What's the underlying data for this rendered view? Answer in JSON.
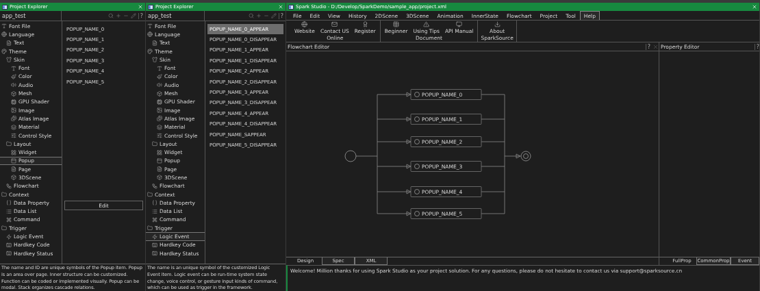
{
  "panels": [
    {
      "title": "Project Explorer",
      "project": "app_test",
      "help": "?",
      "tree": [
        {
          "label": "Font File",
          "selected": false
        },
        {
          "label": "Language",
          "selected": false,
          "children": [
            {
              "label": "Text",
              "selected": false
            }
          ]
        },
        {
          "label": "Theme",
          "selected": false,
          "children": [
            {
              "label": "Skin",
              "selected": false,
              "children": [
                {
                  "label": "Font",
                  "selected": false
                },
                {
                  "label": "Color",
                  "selected": false
                },
                {
                  "label": "Audio",
                  "selected": false
                },
                {
                  "label": "Mesh",
                  "selected": false
                },
                {
                  "label": "GPU Shader",
                  "selected": false
                },
                {
                  "label": "Image",
                  "selected": false
                },
                {
                  "label": "Atlas Image",
                  "selected": false
                },
                {
                  "label": "Material",
                  "selected": false
                },
                {
                  "label": "Control Style",
                  "selected": false
                }
              ]
            },
            {
              "label": "Layout",
              "selected": false,
              "children": [
                {
                  "label": "Widget",
                  "selected": false
                },
                {
                  "label": "Popup",
                  "selected": true
                },
                {
                  "label": "Page",
                  "selected": false
                },
                {
                  "label": "3DScene",
                  "selected": false
                }
              ]
            },
            {
              "label": "Flowchart",
              "selected": false
            }
          ]
        },
        {
          "label": "Context",
          "selected": false,
          "children": [
            {
              "label": "Data Property",
              "selected": false
            },
            {
              "label": "Data List",
              "selected": false
            },
            {
              "label": "Command",
              "selected": false
            }
          ]
        },
        {
          "label": "Trigger",
          "selected": false,
          "children": [
            {
              "label": "Logic Event",
              "selected": false
            },
            {
              "label": "Hardkey Code",
              "selected": false
            },
            {
              "label": "Hardkey Status",
              "selected": false
            }
          ]
        }
      ],
      "list": [
        {
          "label": "POPUP_NAME_0",
          "selected": false
        },
        {
          "label": "POPUP_NAME_1",
          "selected": false
        },
        {
          "label": "POPUP_NAME_2",
          "selected": false
        },
        {
          "label": "POPUP_NAME_3",
          "selected": false
        },
        {
          "label": "POPUP_NAME_4",
          "selected": false
        },
        {
          "label": "POPUP_NAME_5",
          "selected": false
        }
      ],
      "button": "Edit",
      "description": "The name and ID are unique symbols of the Popup item. Popup is an area over page. Inner structure can be customized. Function can be coded or implemented visually. Popup can be modal. Stack organizes cascade relations."
    },
    {
      "title": "Project Explorer",
      "project": "app_test",
      "help": "?",
      "tree": [
        {
          "label": "Font File",
          "selected": false
        },
        {
          "label": "Language",
          "selected": false,
          "children": [
            {
              "label": "Text",
              "selected": false
            }
          ]
        },
        {
          "label": "Theme",
          "selected": false,
          "children": [
            {
              "label": "Skin",
              "selected": false,
              "children": [
                {
                  "label": "Font",
                  "selected": false
                },
                {
                  "label": "Color",
                  "selected": false
                },
                {
                  "label": "Audio",
                  "selected": false
                },
                {
                  "label": "Mesh",
                  "selected": false
                },
                {
                  "label": "GPU Shader",
                  "selected": false
                },
                {
                  "label": "Image",
                  "selected": false
                },
                {
                  "label": "Atlas Image",
                  "selected": false
                },
                {
                  "label": "Material",
                  "selected": false
                },
                {
                  "label": "Control Style",
                  "selected": false
                }
              ]
            },
            {
              "label": "Layout",
              "selected": false,
              "children": [
                {
                  "label": "Widget",
                  "selected": false
                },
                {
                  "label": "Popup",
                  "selected": false
                },
                {
                  "label": "Page",
                  "selected": false
                },
                {
                  "label": "3DScene",
                  "selected": false
                }
              ]
            },
            {
              "label": "Flowchart",
              "selected": false
            }
          ]
        },
        {
          "label": "Context",
          "selected": false,
          "children": [
            {
              "label": "Data Property",
              "selected": false
            },
            {
              "label": "Data List",
              "selected": false
            },
            {
              "label": "Command",
              "selected": false
            }
          ]
        },
        {
          "label": "Trigger",
          "selected": false,
          "children": [
            {
              "label": "Logic Event",
              "selected": true
            },
            {
              "label": "Hardkey Code",
              "selected": false
            },
            {
              "label": "Hardkey Status",
              "selected": false
            }
          ]
        }
      ],
      "list": [
        {
          "label": "POPUP_NAME_0_APPEAR",
          "selected": true
        },
        {
          "label": "POPUP_NAME_0_DISAPPEAR",
          "selected": false
        },
        {
          "label": "POPUP_NAME_1_APPEAR",
          "selected": false
        },
        {
          "label": "POPUP_NAME_1_DISAPPEAR",
          "selected": false
        },
        {
          "label": "POPUP_NAME_2_APPEAR",
          "selected": false
        },
        {
          "label": "POPUP_NAME_2_DISAPPEAR",
          "selected": false
        },
        {
          "label": "POPUP_NAME_3_APPEAR",
          "selected": false
        },
        {
          "label": "POPUP_NAME_3_DISAPPEAR",
          "selected": false
        },
        {
          "label": "POPUP_NAME_4_APPEAR",
          "selected": false
        },
        {
          "label": "POPUP_NAME_4_DISAPPEAR",
          "selected": false
        },
        {
          "label": "POPUP_NAME_SAPPEAR",
          "selected": false
        },
        {
          "label": "POPUP_NAME_5_DISAPPEAR",
          "selected": false
        }
      ],
      "description": "The name is an unique symbol of the customized Logic Event item. Logic event can be run-time system state change, voice control, or gesture input kinds of command, which can be used as trigger in the framework."
    }
  ],
  "main": {
    "title": "Spark Studio - D:/Develop/SparkDemo/sample_app/project.xml",
    "menu": [
      {
        "label": "File",
        "selected": false
      },
      {
        "label": "Edit",
        "selected": false
      },
      {
        "label": "View",
        "selected": false
      },
      {
        "label": "History",
        "selected": false
      },
      {
        "label": "2DScene",
        "selected": false
      },
      {
        "label": "3DScene",
        "selected": false
      },
      {
        "label": "Animation",
        "selected": false
      },
      {
        "label": "InnerState",
        "selected": false
      },
      {
        "label": "Flowchart",
        "selected": false
      },
      {
        "label": "Project",
        "selected": false
      },
      {
        "label": "Tool",
        "selected": false
      },
      {
        "label": "Help",
        "selected": true
      }
    ],
    "ribbon": [
      {
        "group": "Online",
        "buttons": [
          "Website",
          "Contact US",
          "Register"
        ]
      },
      {
        "group": "Document",
        "buttons": [
          "Beginner",
          "Using Tips",
          "API Manual"
        ]
      },
      {
        "group": "SparkSource",
        "buttons": [
          "About"
        ]
      }
    ],
    "flowchart": {
      "title": "Flowchart Editor",
      "help": "?",
      "nodes": [
        "POPUP_NAME_0",
        "POPUP_NAME_1",
        "POPUP_NAME_2",
        "POPUP_NAME_3",
        "POPUP_NAME_4",
        "POPUP_NAME_5"
      ]
    },
    "editor_tabs": [
      {
        "label": "Design",
        "selected": true
      },
      {
        "label": "Spec",
        "selected": false
      },
      {
        "label": "XML",
        "selected": false
      }
    ],
    "property_editor": {
      "title": "Property Editor",
      "help": "?",
      "tabs": [
        {
          "label": "FullProp",
          "selected": true
        },
        {
          "label": "CommonProp",
          "selected": false
        },
        {
          "label": "Event",
          "selected": false
        }
      ]
    },
    "status": "Welcome! Million thanks for using Spark Studio as your project solution. For any questions, please do not hesitate to contact us via support@sparksource.cn"
  }
}
